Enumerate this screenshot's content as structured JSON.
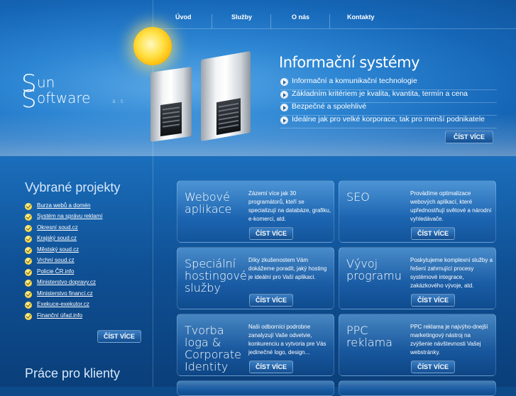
{
  "nav": {
    "items": [
      "Úvod",
      "Služby",
      "O nás",
      "Kontakty"
    ]
  },
  "logo": {
    "line1_initial": "S",
    "line1_rest": "un",
    "line2_initial": "S",
    "line2_rest": "oftware",
    "suffix": "a.s."
  },
  "hero": {
    "headline": "Informační systémy",
    "features": [
      "Informační a komunikační technologie",
      "Základním kritériem je kvalita, kvantita, termín a cena",
      "Bezpečné a spolehlivé",
      "Ideálne jak pro velké korporace, tak pro menší podnikatele"
    ],
    "button": "ČÍST VÍCE"
  },
  "projects": {
    "title": "Vybrané projekty",
    "items": [
      "Burza webů a domén",
      "Systém na správu reklamí",
      "Okresní soud.cz",
      "Krajský soud.cz",
      "Městský soud.cz",
      "Vrchní soud.cz",
      "Policie ČR.info",
      "Ministerstvo dopravy.cz",
      "Ministerstvo financí.cz",
      "Exekuce-exekutor.cz",
      "Finanční úřad.info"
    ],
    "button": "ČÍST VÍCE"
  },
  "clients": {
    "title": "Práce pro klienty"
  },
  "cards": [
    {
      "title": "Webové aplikace",
      "text": "Zázemí více jak 30 programátorů, kteří se specializují na databáze, grafiku, e-komerci, atd.",
      "button": "ČÍST VÍCE"
    },
    {
      "title": "SEO",
      "text": "Provádíme optimalizace webových aplikací, které upřednostňují světové a národní vyhledávače.",
      "button": "ČÍST VÍCE"
    },
    {
      "title": "Speciální hostingové služby",
      "text": "Díky zkušenostem Vám dokážeme poradit, jaký hosting je ideální pro Vaší aplikaci.",
      "button": "ČÍST VÍCE"
    },
    {
      "title": "Vývoj programu",
      "text": "Poskytujeme komplexní služby a řešení zahrnující procesy systémové integrace, zakázkového vývoje, atd.",
      "button": "ČÍST VÍCE"
    },
    {
      "title": "Tvorba loga & Corporate Identity",
      "text": "Naši odborníci podrobne zanalyzují Vaše odvetvie, konkurenciu a vytvoria pre Vás jedinečné logo, design...",
      "button": "ČÍST VÍCE"
    },
    {
      "title": "PPC reklama",
      "text": "PPC reklama je najvýho-dnejší marketingový nástroj na zvýšenie návštevnosti Vašej webstránky.",
      "button": "ČÍST VÍCE"
    }
  ]
}
